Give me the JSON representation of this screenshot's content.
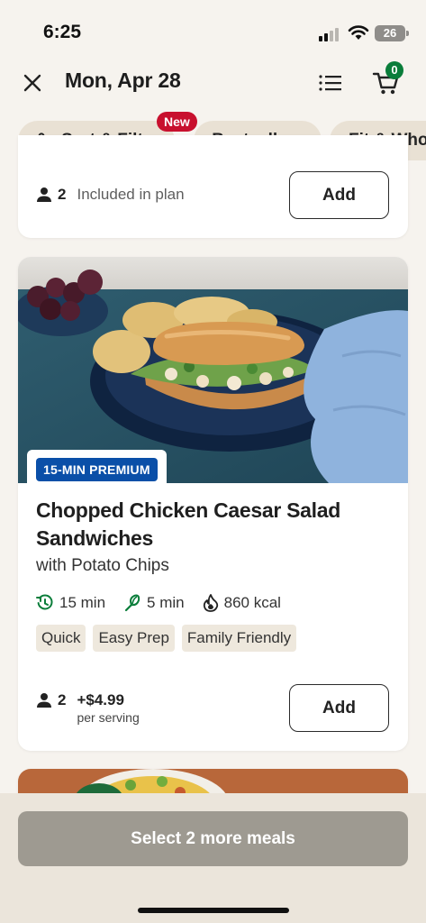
{
  "status": {
    "time": "6:25",
    "battery": "26"
  },
  "header": {
    "title": "Mon, Apr 28",
    "cart_count": "0"
  },
  "filters": {
    "new_badge": "New",
    "items": [
      {
        "label": "Sort & Filter"
      },
      {
        "label": "Bestsellers"
      },
      {
        "label": "Fit & Who"
      }
    ]
  },
  "card_prev": {
    "servings": "2",
    "status": "Included in plan",
    "add_label": "Add"
  },
  "meal": {
    "badge": "15-MIN PREMIUM",
    "title": "Chopped Chicken Caesar Salad Sandwiches",
    "subtitle": "with Potato Chips",
    "total_time": "15 min",
    "prep_time": "5 min",
    "calories": "860 kcal",
    "tags": [
      "Quick",
      "Easy Prep",
      "Family Friendly"
    ],
    "servings": "2",
    "price": "+$4.99",
    "price_unit": "per serving",
    "add_label": "Add"
  },
  "footer": {
    "cta": "Select 2 more meals"
  },
  "colors": {
    "brand_green": "#0a7d3a",
    "premium_blue": "#0a4fa8",
    "new_red": "#c8102e"
  }
}
